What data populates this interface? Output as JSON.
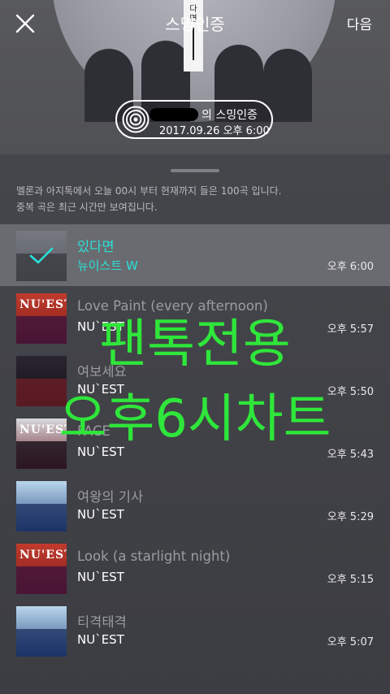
{
  "header": {
    "title": "스밍인증",
    "next_label": "다음",
    "strip_text_1": "다",
    "strip_text_2": "면"
  },
  "badge": {
    "label": "의 스밍인증",
    "datetime": "2017.09.26 오후 6:00"
  },
  "info": {
    "line1": "멜론과 아지톡에서 오늘 00시 부터 현재까지 들은 100곡 입니다.",
    "line2": "중복 곡은 최근 시간만 보여집니다."
  },
  "songs": [
    {
      "title": "있다면",
      "artist": "뉴이스트 W",
      "time": "오후 6:00",
      "selected": true,
      "cover": "nuest-w"
    },
    {
      "title": "Love Paint (every afternoon)",
      "artist": "NU`EST",
      "time": "오후 5:57",
      "selected": false,
      "cover": "nuest-red"
    },
    {
      "title": "여보세요",
      "artist": "NU`EST",
      "time": "오후 5:50",
      "selected": false,
      "cover": "nuest-dark"
    },
    {
      "title": "FACE",
      "artist": "NU`EST",
      "time": "오후 5:43",
      "selected": false,
      "cover": "nuest-face"
    },
    {
      "title": "여왕의 기사",
      "artist": "NU`EST",
      "time": "오후 5:29",
      "selected": false,
      "cover": "nuest-blue"
    },
    {
      "title": "Look (a starlight night)",
      "artist": "NU`EST",
      "time": "오후 5:15",
      "selected": false,
      "cover": "nuest-red"
    },
    {
      "title": "티격태격",
      "artist": "NU`EST",
      "time": "오후 5:07",
      "selected": false,
      "cover": "nuest-blue"
    }
  ],
  "overlay": {
    "line1": "팬톡전용",
    "line2": "오후6시차트"
  },
  "colors": {
    "accent": "#29e0d6",
    "overlay": "#2fe63a"
  },
  "icons": {
    "close": "close-icon",
    "disc": "disc-icon",
    "check": "check-icon"
  }
}
